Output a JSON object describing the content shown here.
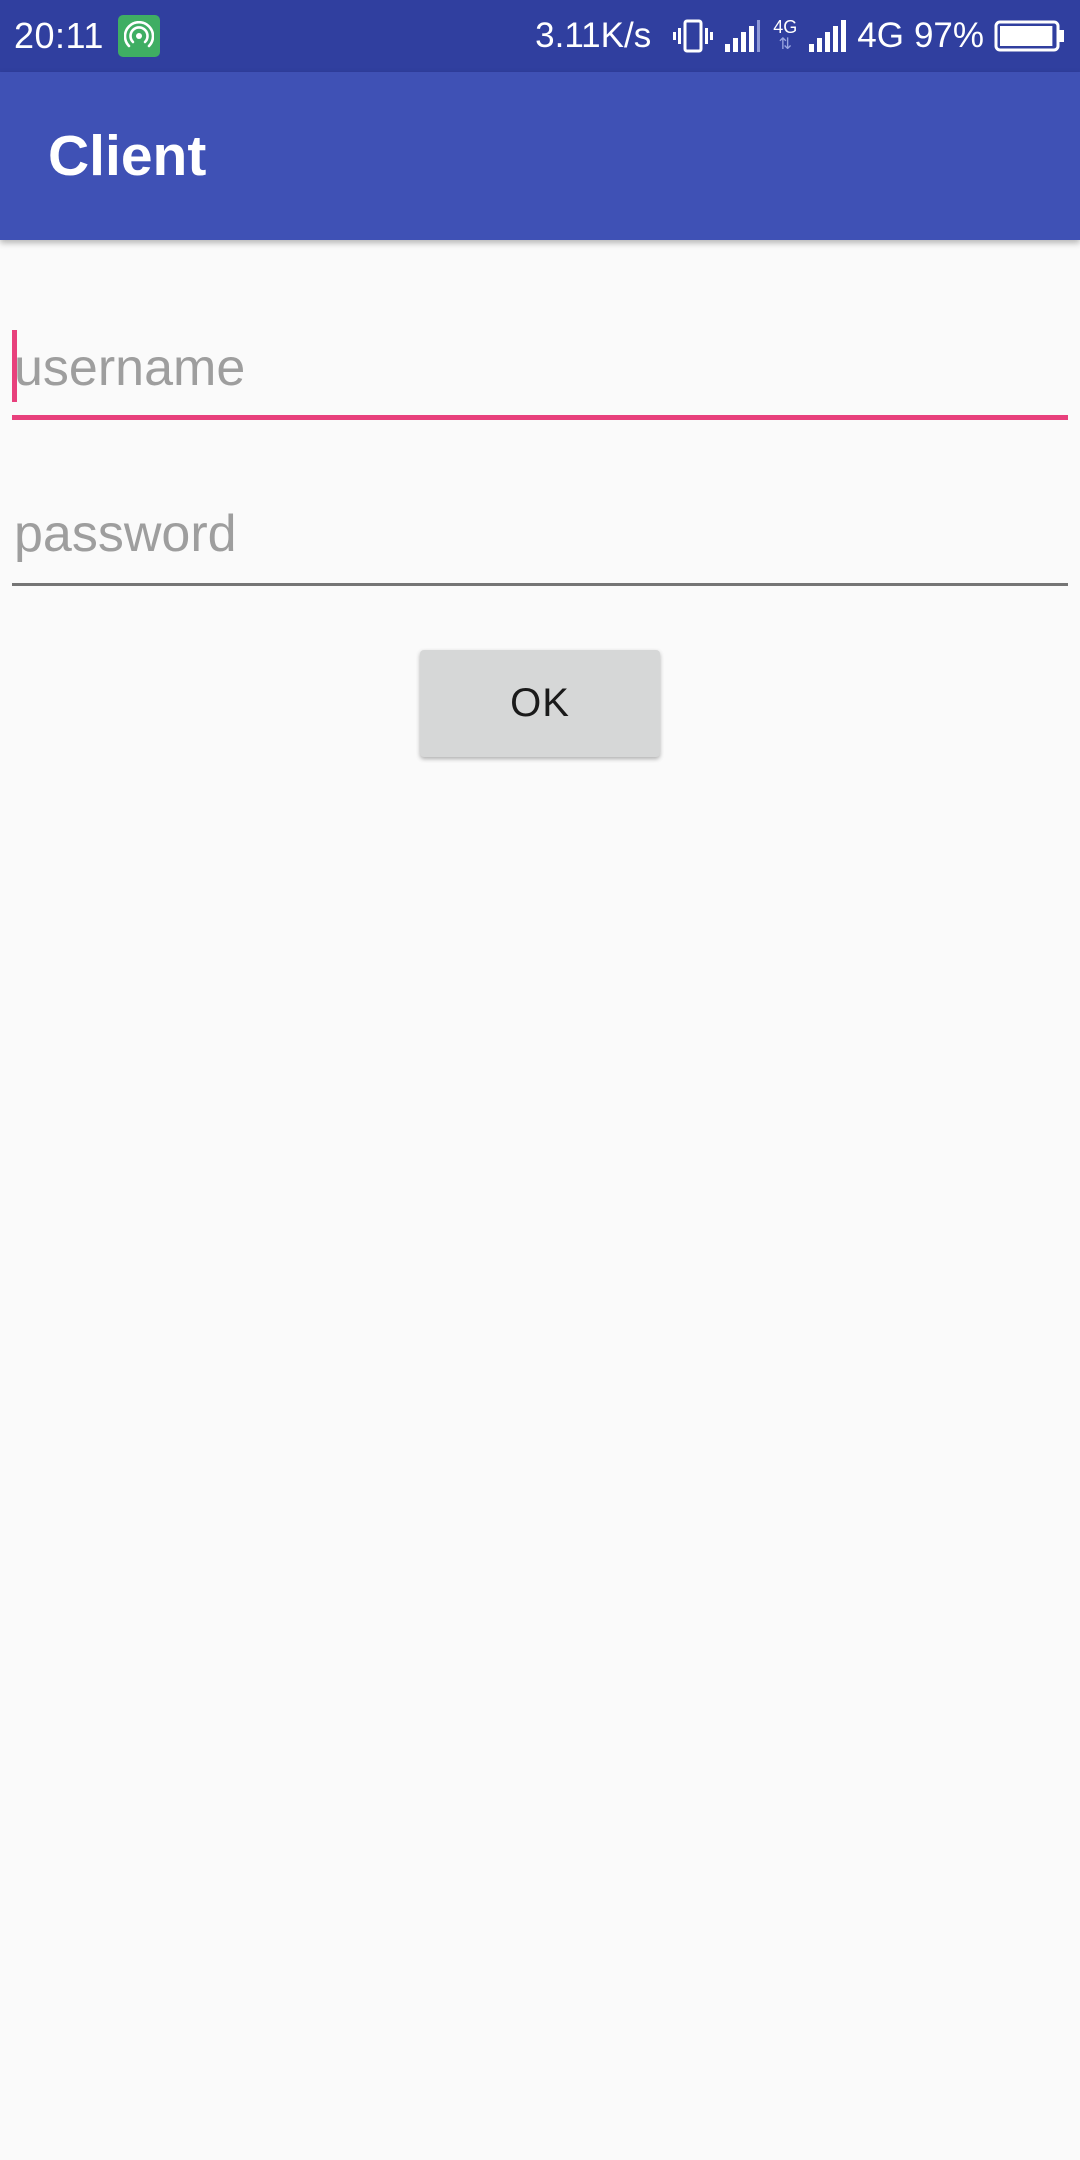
{
  "status_bar": {
    "time": "20:11",
    "net_speed": "3.11K/s",
    "secondary_network": "4G",
    "network_type": "4G",
    "battery": "97%",
    "battery_level": 0.97,
    "icons": [
      "hotspot-icon",
      "vibrate-icon",
      "signal-icon",
      "signal-icon",
      "battery-icon"
    ]
  },
  "app_bar": {
    "title": "Client"
  },
  "form": {
    "username_placeholder": "username",
    "password_placeholder": "password",
    "ok_label": "OK"
  },
  "colors": {
    "status_bar": "#303f9f",
    "app_bar": "#3f51b5",
    "accent": "#e8407c",
    "button": "#d6d7d7",
    "background": "#fafafa"
  }
}
